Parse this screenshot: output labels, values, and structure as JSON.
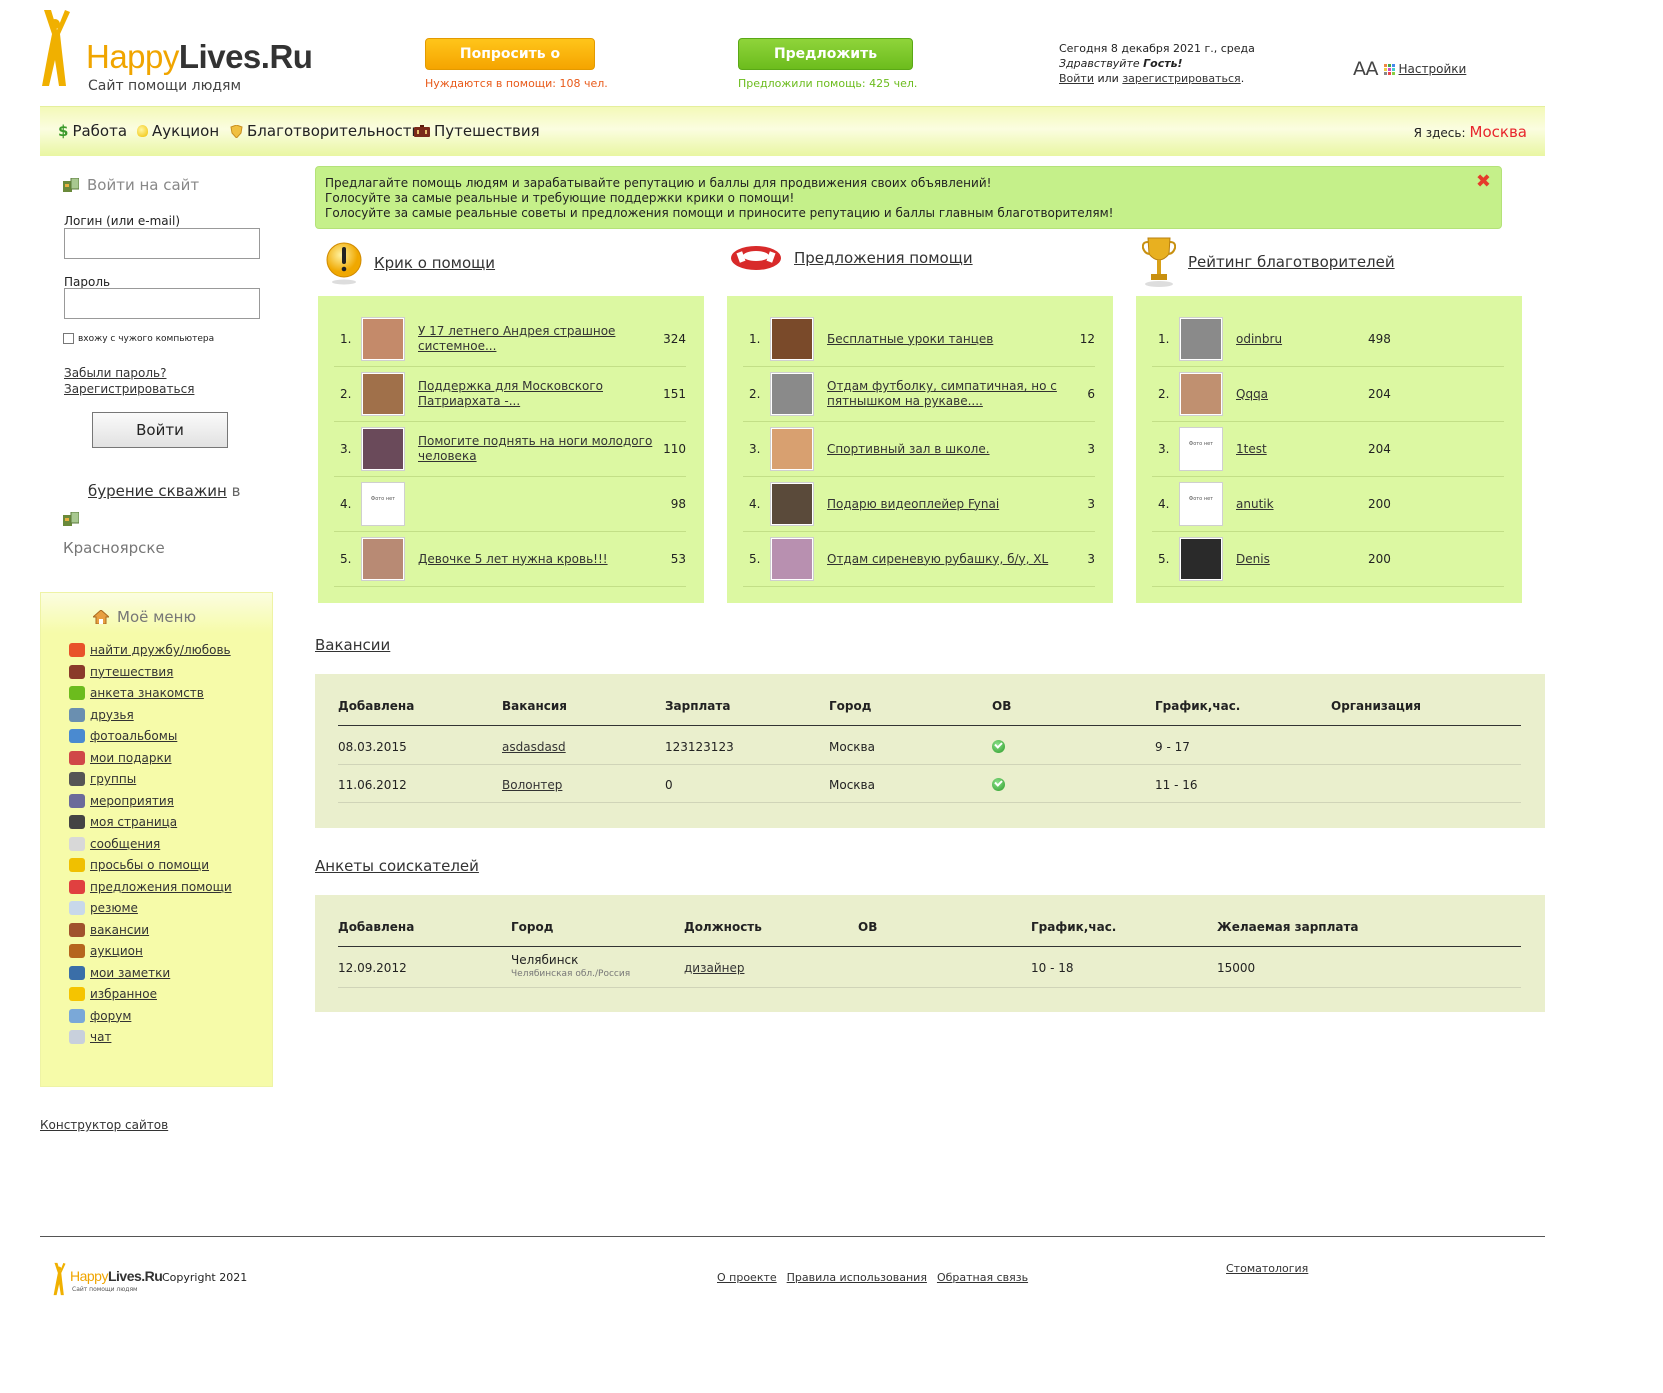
{
  "header": {
    "logo_happy": "Happy",
    "logo_lives": "Lives.Ru",
    "logo_sub": "Сайт помощи людям",
    "ask_button": "Попросить о помощи!",
    "offer_button": "Предложить помощь!",
    "need_count": "Нуждаются в помощи: 108 чел.",
    "offer_count": "Предложили помощь: 425 чел.",
    "date_line": "Сегодня 8 декабря 2021 г., среда",
    "greeting_pre": "Здравствуйте",
    "greeting_name": "Гость!",
    "login_link": "Войти",
    "or": "или",
    "register_link": "зарегистрироваться",
    "font_size_glyph": "AA",
    "settings_link": "Настройки"
  },
  "nav": {
    "items": [
      {
        "label": "Работа",
        "icon": "dollar-icon"
      },
      {
        "label": "Аукцион",
        "icon": "bulb-icon"
      },
      {
        "label": "Благотворительность",
        "icon": "shield-icon"
      },
      {
        "label": "Путешествия",
        "icon": "suitcase-icon"
      }
    ],
    "where_label": "Я здесь:",
    "city": "Москва"
  },
  "login": {
    "title": "Войти на сайт",
    "login_label": "Логин (или e-mail)",
    "password_label": "Пароль",
    "remember": "вхожу с чужого компьютера",
    "forgot": "Забыли пароль?",
    "register": "Зарегистрироваться",
    "submit": "Войти"
  },
  "ad": {
    "link": "бурение скважин",
    "in": "в",
    "city": "Красноярске"
  },
  "mymenu": {
    "title": "Моё меню",
    "items": [
      {
        "label": "найти дружбу/любовь",
        "color": "#e8522a"
      },
      {
        "label": "путешествия",
        "color": "#8a3a2a"
      },
      {
        "label": "анкета знакомств",
        "color": "#6cbc1d"
      },
      {
        "label": "друзья",
        "color": "#6a8fb0"
      },
      {
        "label": "фотоальбомы",
        "color": "#4a8ad0"
      },
      {
        "label": "мои подарки",
        "color": "#d04848"
      },
      {
        "label": "группы",
        "color": "#555555"
      },
      {
        "label": "мероприятия",
        "color": "#6b6b9a"
      },
      {
        "label": "моя страница",
        "color": "#444444"
      },
      {
        "label": "сообщения",
        "color": "#d8d8d8"
      },
      {
        "label": "просьбы о помощи",
        "color": "#f0c000"
      },
      {
        "label": "предложения помощи",
        "color": "#e04040"
      },
      {
        "label": "резюме",
        "color": "#c8d8ea"
      },
      {
        "label": "вакансии",
        "color": "#a0522d"
      },
      {
        "label": "аукцион",
        "color": "#b5651d"
      },
      {
        "label": "мои заметки",
        "color": "#3a6ea8"
      },
      {
        "label": "избранное",
        "color": "#f5c400"
      },
      {
        "label": "форум",
        "color": "#7aa8d8"
      },
      {
        "label": "чат",
        "color": "#c8d0dc"
      }
    ]
  },
  "constructor_link": "Конструктор сайтов",
  "info": {
    "line1": "Предлагайте помощь людям и зарабатывайте репутацию и баллы для продвижения своих объявлений!",
    "line2": "Голосуйте за самые реальные и требующие поддержки крики о помощи!",
    "line3": "Голосуйте за самые реальные советы и предложения помощи и приносите репутацию и баллы главным благотворителям!",
    "close": "✖"
  },
  "columns": [
    {
      "title": "Крик о помощи",
      "rows": [
        {
          "n": "1.",
          "text": "У 17 летнего Андрея страшное системное...",
          "value": "324",
          "thumb": "#c48a6a"
        },
        {
          "n": "2.",
          "text": "Поддержка для Московского Патриархата -...",
          "value": "151",
          "thumb": "#a0704a"
        },
        {
          "n": "3.",
          "text": "Помогите поднять на ноги молодого человека",
          "value": "110",
          "thumb": "#6a4a5a"
        },
        {
          "n": "4.",
          "text": "",
          "value": "98",
          "thumb": "#ffffff"
        },
        {
          "n": "5.",
          "text": "Девочке 5 лет нужна кровь!!!",
          "value": "53",
          "thumb": "#b88a74"
        }
      ]
    },
    {
      "title": "Предложения помощи",
      "rows": [
        {
          "n": "1.",
          "text": "Бесплатные уроки танцев",
          "value": "12",
          "thumb": "#7a4a2a"
        },
        {
          "n": "2.",
          "text": "Отдам футболку, симпатичная, но с пятнышком на рукаве....",
          "value": "6",
          "thumb": "#8a8a8a"
        },
        {
          "n": "3.",
          "text": "Спортивный зал в школе.",
          "value": "3",
          "thumb": "#d8a070"
        },
        {
          "n": "4.",
          "text": "Подарю видеоплейер Fynai",
          "value": "3",
          "thumb": "#5a4a3a"
        },
        {
          "n": "5.",
          "text": "Отдам сиреневую рубашку, б/у, XL",
          "value": "3",
          "thumb": "#b890b0"
        }
      ]
    },
    {
      "title": "Рейтинг благотворителей",
      "rows": [
        {
          "n": "1.",
          "text": "odinbru",
          "value": "498",
          "thumb": "#8a8a8a"
        },
        {
          "n": "2.",
          "text": "Qqqa",
          "value": "204",
          "thumb": "#c09070"
        },
        {
          "n": "3.",
          "text": "1test",
          "value": "204",
          "thumb": "#ffffff"
        },
        {
          "n": "4.",
          "text": "anutik",
          "value": "200",
          "thumb": "#ffffff"
        },
        {
          "n": "5.",
          "text": "Denis",
          "value": "200",
          "thumb": "#2a2a2a"
        }
      ]
    }
  ],
  "no_photo": "Фото нет",
  "vacancies": {
    "title": "Вакансии",
    "headers": [
      "Добавлена",
      "Вакансия",
      "Зарплата",
      "Город",
      "ОВ",
      "График,час.",
      "Организация"
    ],
    "rows": [
      {
        "added": "08.03.2015",
        "vacancy": "asdasdasd",
        "salary": "123123123",
        "city": "Москва",
        "hours": "9 - 17"
      },
      {
        "added": "11.06.2012",
        "vacancy": "Волонтер",
        "salary": "0",
        "city": "Москва",
        "hours": "11 - 16"
      }
    ]
  },
  "seekers": {
    "title": "Анкеты соискателей",
    "headers": [
      "Добавлена",
      "Город",
      "Должность",
      "ОВ",
      "График,час.",
      "Желаемая зарплата"
    ],
    "rows": [
      {
        "added": "12.09.2012",
        "city": "Челябинск",
        "region": "Челябинская обл./Россия",
        "position": "дизайнер",
        "hours": "10 - 18",
        "salary": "15000"
      }
    ]
  },
  "footer": {
    "logo_happy": "Happy",
    "logo_lives": "Lives.Ru",
    "logo_sub": "Сайт помощи людям",
    "copyright": "Copyright 2021",
    "links": [
      "О проекте",
      "Правила использования",
      "Обратная связь"
    ],
    "right_link": "Стоматология"
  }
}
